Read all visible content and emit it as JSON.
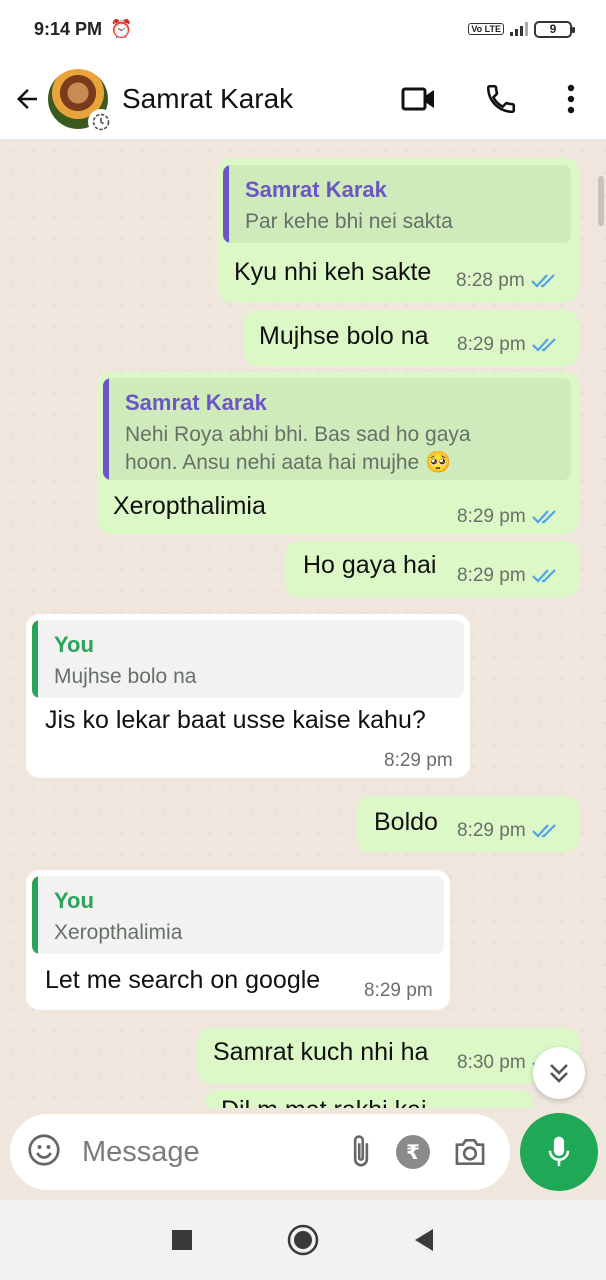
{
  "status_bar": {
    "time": "9:14 PM",
    "network_badge": "Vo LTE",
    "battery": "9"
  },
  "header": {
    "contact_name": "Samrat Karak"
  },
  "messages": [
    {
      "direction": "out",
      "quote_author": "Samrat Karak",
      "quote_text": "Par kehe bhi nei sakta",
      "text": "Kyu nhi keh sakte",
      "time": "8:28 pm"
    },
    {
      "direction": "out",
      "text": "Mujhse bolo na",
      "time": "8:29 pm"
    },
    {
      "direction": "out",
      "quote_author": "Samrat Karak",
      "quote_text_line1": "Nehi Roya abhi bhi. Bas sad ho gaya",
      "quote_text_line2": "hoon. Ansu nehi aata hai mujhe 🥺",
      "text": "Xeropthalimia",
      "time": "8:29 pm"
    },
    {
      "direction": "out",
      "text": "Ho gaya hai",
      "time": "8:29 pm"
    },
    {
      "direction": "in",
      "quote_author": "You",
      "quote_text": "Mujhse bolo na",
      "text": "Jis ko lekar baat usse kaise kahu?",
      "time": "8:29 pm"
    },
    {
      "direction": "out",
      "text": "Boldo",
      "time": "8:29 pm"
    },
    {
      "direction": "in",
      "quote_author": "You",
      "quote_text": "Xeropthalimia",
      "text": "Let me search on google",
      "time": "8:29 pm"
    },
    {
      "direction": "out",
      "text": "Samrat kuch nhi ha",
      "time": "8:30 pm"
    },
    {
      "direction": "out",
      "text": "Dil m mat rakhi kai"
    }
  ],
  "composer": {
    "placeholder": "Message"
  },
  "colors": {
    "outgoing_bubble": "#dcf8c6",
    "incoming_bubble": "#ffffff",
    "quote_author_contact": "#6b55c7",
    "quote_author_you": "#2aa45a",
    "read_ticks": "#4fa3e6",
    "mic_button": "#1fa855"
  },
  "icons": [
    "back-arrow-icon",
    "video-call-icon",
    "voice-call-icon",
    "more-options-icon",
    "emoji-icon",
    "attach-icon",
    "rupee-icon",
    "camera-icon",
    "mic-icon",
    "scroll-down-icon",
    "nav-recents-icon",
    "nav-home-icon",
    "nav-back-icon"
  ]
}
